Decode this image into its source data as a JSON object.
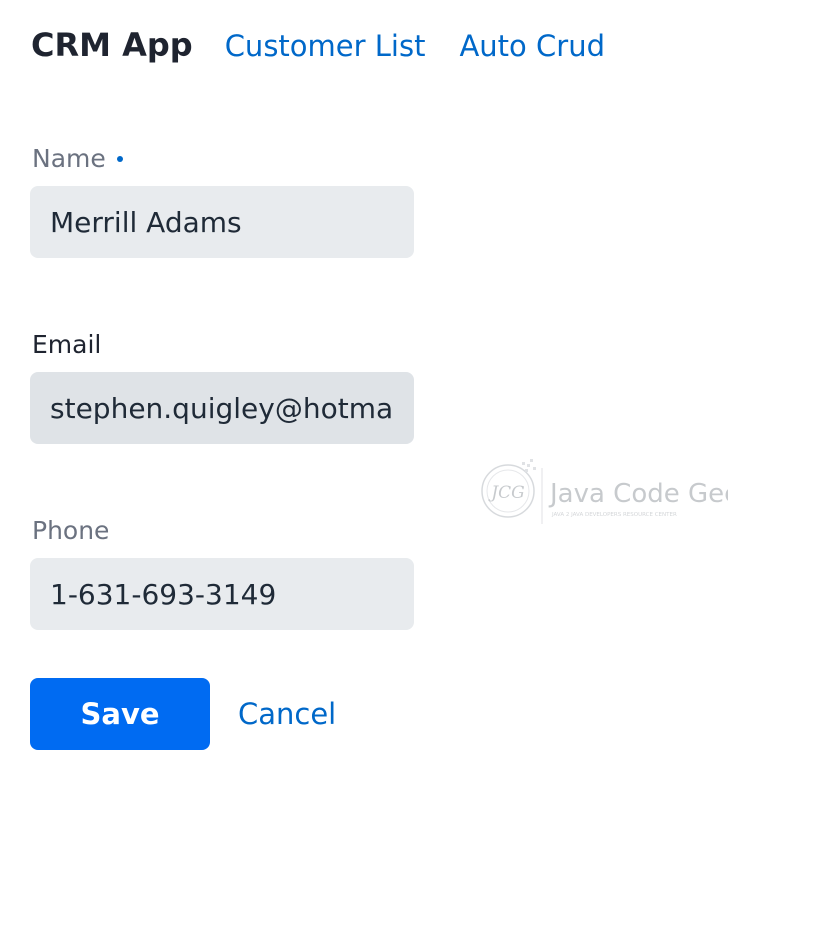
{
  "header": {
    "app_title": "CRM App",
    "links": [
      {
        "label": "Customer List"
      },
      {
        "label": "Auto Crud"
      }
    ]
  },
  "form": {
    "name": {
      "label": "Name",
      "value": "Merrill Adams",
      "required": true
    },
    "email": {
      "label": "Email",
      "value": "stephen.quigley@hotmail.com"
    },
    "phone": {
      "label": "Phone",
      "value": "1-631-693-3149"
    }
  },
  "actions": {
    "save_label": "Save",
    "cancel_label": "Cancel"
  },
  "watermark": {
    "logo_text": "Java Code Geeks",
    "tagline": "JAVA 2 JAVA DEVELOPERS RESOURCE CENTER",
    "monogram": "JCG"
  },
  "colors": {
    "accent": "#0068c9",
    "primary_button": "#006bf2",
    "input_background": "#e8ebee"
  }
}
